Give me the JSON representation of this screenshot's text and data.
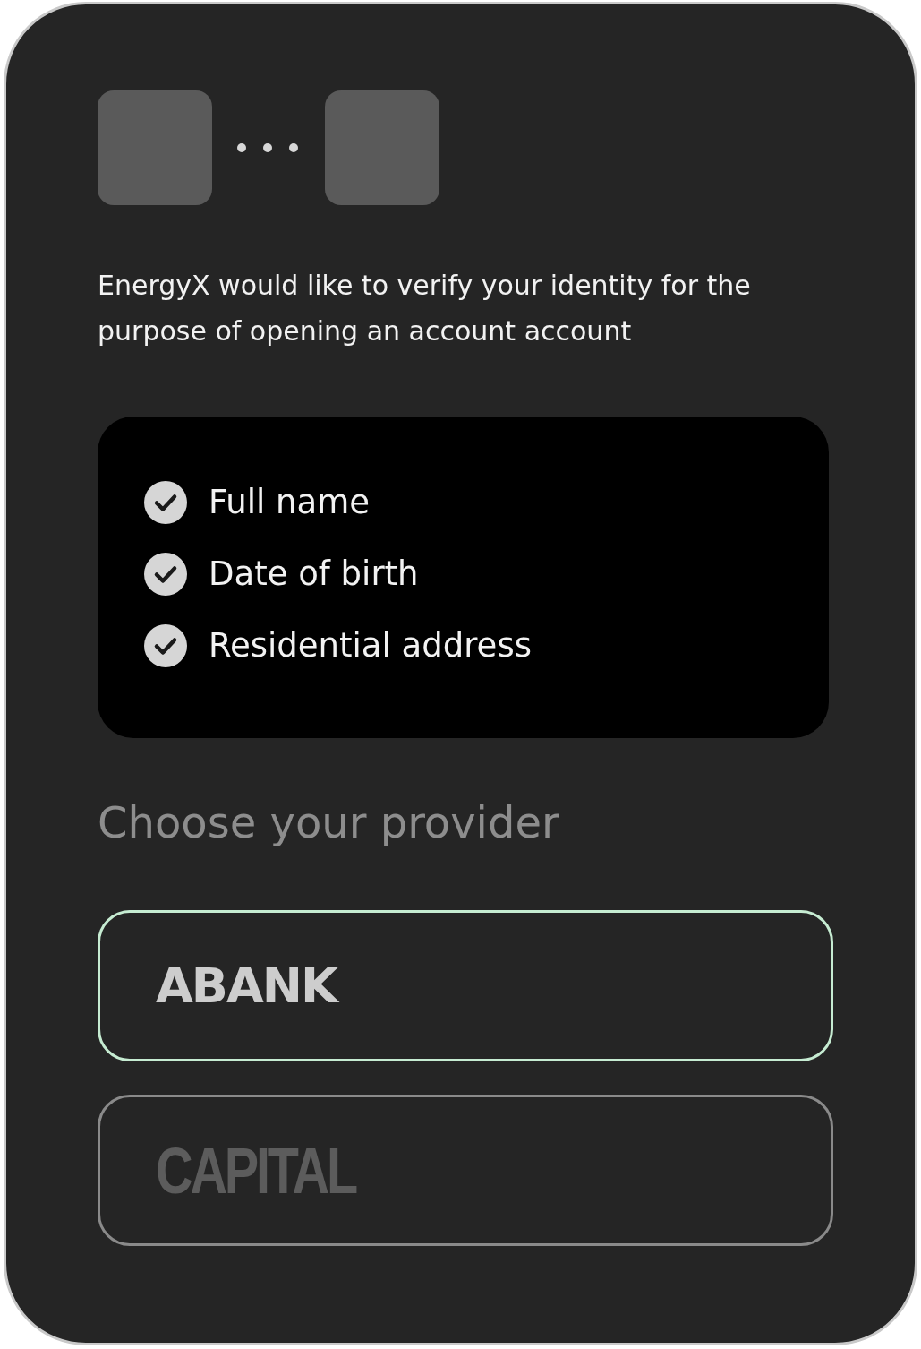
{
  "message": "EnergyX would like to verify your identity for the purpose of opening an account account",
  "permissions": [
    {
      "label": "Full name",
      "checked": true
    },
    {
      "label": "Date of birth",
      "checked": true
    },
    {
      "label": "Residential address",
      "checked": true
    }
  ],
  "provider_heading": "Choose your provider",
  "providers": [
    {
      "name": "ABANK",
      "kind": "extended",
      "selected": true
    },
    {
      "name": "CAPITAL",
      "kind": "condensed",
      "selected": false
    }
  ]
}
